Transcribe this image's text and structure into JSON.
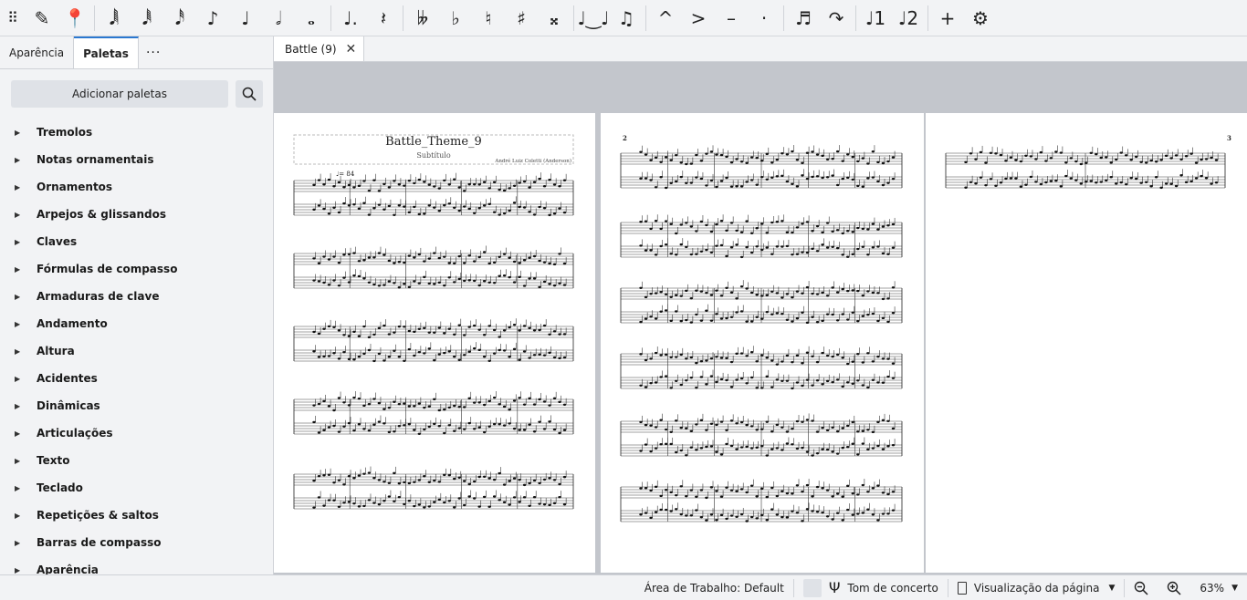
{
  "toolbar": {
    "items": [
      {
        "name": "drag-handle-icon",
        "glyph": "⠿"
      },
      {
        "name": "note-input-pencil-icon",
        "glyph": "✎"
      },
      {
        "name": "pin-icon",
        "glyph": "📍"
      },
      {
        "name": "sixty-fourth-note-icon",
        "glyph": "𝅘𝅥𝅲"
      },
      {
        "name": "thirty-second-note-icon",
        "glyph": "𝅘𝅥𝅱"
      },
      {
        "name": "sixteenth-note-icon",
        "glyph": "𝅘𝅥𝅰"
      },
      {
        "name": "eighth-note-icon",
        "glyph": "♪"
      },
      {
        "name": "quarter-note-icon",
        "glyph": "♩"
      },
      {
        "name": "half-note-icon",
        "glyph": "𝅗𝅥"
      },
      {
        "name": "whole-note-icon",
        "glyph": "𝅝"
      },
      {
        "name": "augmentation-dot-icon",
        "glyph": "♩."
      },
      {
        "name": "rest-icon",
        "glyph": "𝄽"
      },
      {
        "name": "double-flat-icon",
        "glyph": "𝄫"
      },
      {
        "name": "flat-icon",
        "glyph": "♭"
      },
      {
        "name": "natural-icon",
        "glyph": "♮"
      },
      {
        "name": "sharp-icon",
        "glyph": "♯"
      },
      {
        "name": "double-sharp-icon",
        "glyph": "𝄪"
      },
      {
        "name": "tie-icon",
        "glyph": "♩‿♩"
      },
      {
        "name": "slur-icon",
        "glyph": "♫"
      },
      {
        "name": "marcato-icon",
        "glyph": "^"
      },
      {
        "name": "accent-icon",
        "glyph": ">"
      },
      {
        "name": "tenuto-icon",
        "glyph": "–"
      },
      {
        "name": "staccato-icon",
        "glyph": "·"
      },
      {
        "name": "tuplet-icon",
        "glyph": "♬"
      },
      {
        "name": "flip-direction-icon",
        "glyph": "↷"
      },
      {
        "name": "voice-1-icon",
        "glyph": "♩1"
      },
      {
        "name": "voice-2-icon",
        "glyph": "♩2"
      },
      {
        "name": "add-icon",
        "glyph": "+"
      },
      {
        "name": "settings-gear-icon",
        "glyph": "⚙"
      }
    ]
  },
  "panel": {
    "tabs": [
      "Aparência",
      "Paletas"
    ],
    "active_tab": "Paletas",
    "more": "···",
    "add_palettes": "Adicionar paletas",
    "palettes": [
      "Tremolos",
      "Notas ornamentais",
      "Ornamentos",
      "Arpejos & glissandos",
      "Claves",
      "Fórmulas de compasso",
      "Armaduras de clave",
      "Andamento",
      "Altura",
      "Acidentes",
      "Dinâmicas",
      "Articulações",
      "Texto",
      "Teclado",
      "Repetições & saltos",
      "Barras de compasso",
      "Aparência"
    ]
  },
  "document": {
    "tab_label": "Battle (9)",
    "title": "Battle_Theme_9",
    "subtitle": "Subtítulo",
    "composer": "André Luiz Coletti (Anderson)",
    "tempo": "♩= 84",
    "page2_number": "2",
    "page3_number": "3",
    "ped_marking": "𝆮."
  },
  "status": {
    "workspace": "Área de Trabalho: Default",
    "concert_pitch": "Tom de concerto",
    "view_mode": "Visualização da página",
    "zoom": "63%"
  }
}
